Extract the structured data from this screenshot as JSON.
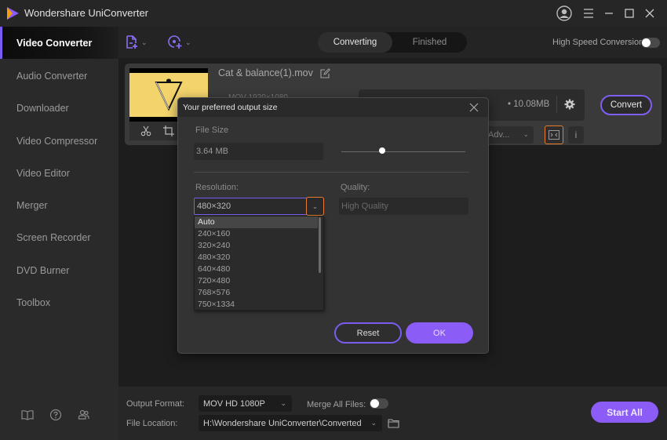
{
  "app": {
    "title": "Wondershare UniConverter",
    "window_controls": [
      "account-icon",
      "menu-icon",
      "minimize-icon",
      "maximize-icon",
      "close-icon"
    ]
  },
  "sidebar": {
    "items": [
      {
        "label": "Video Converter",
        "active": true
      },
      {
        "label": "Audio Converter",
        "active": false
      },
      {
        "label": "Downloader",
        "active": false
      },
      {
        "label": "Video Compressor",
        "active": false
      },
      {
        "label": "Video Editor",
        "active": false
      },
      {
        "label": "Merger",
        "active": false
      },
      {
        "label": "Screen Recorder",
        "active": false
      },
      {
        "label": "DVD Burner",
        "active": false
      },
      {
        "label": "Toolbox",
        "active": false
      }
    ],
    "bottom_icons": [
      "book-icon",
      "help-icon",
      "community-icon"
    ]
  },
  "toolbar": {
    "tabs": [
      {
        "label": "Converting",
        "active": true
      },
      {
        "label": "Finished",
        "active": false
      }
    ],
    "high_speed_label": "High Speed Conversion",
    "high_speed_on": false
  },
  "file": {
    "name": "Cat & balance(1).mov",
    "meta_faint": "MOV      1920×1080",
    "output_size": "• 10.08MB",
    "convert_label": "Convert",
    "adv_label": "Adv..."
  },
  "dialog": {
    "title": "Your preferred output size",
    "file_size_label": "File Size",
    "file_size_value": "3.64 MB",
    "slider_fraction": 0.33,
    "resolution_label": "Resolution:",
    "resolution_value": "480×320",
    "quality_label": "Quality:",
    "quality_placeholder": "High Quality",
    "resolution_options": [
      "Auto",
      "240×160",
      "320×240",
      "480×320",
      "640×480",
      "720×480",
      "768×576",
      "750×1334"
    ],
    "highlighted_option": "Auto",
    "reset_label": "Reset",
    "ok_label": "OK"
  },
  "bottom": {
    "output_format_label": "Output Format:",
    "output_format_value": "MOV HD 1080P",
    "merge_label": "Merge All Files:",
    "merge_on": false,
    "file_location_label": "File Location:",
    "file_location_value": "H:\\Wondershare UniConverter\\Converted",
    "start_all_label": "Start All"
  },
  "colors": {
    "accent": "#8b5cf6",
    "highlight_outline": "#e67d2e"
  }
}
